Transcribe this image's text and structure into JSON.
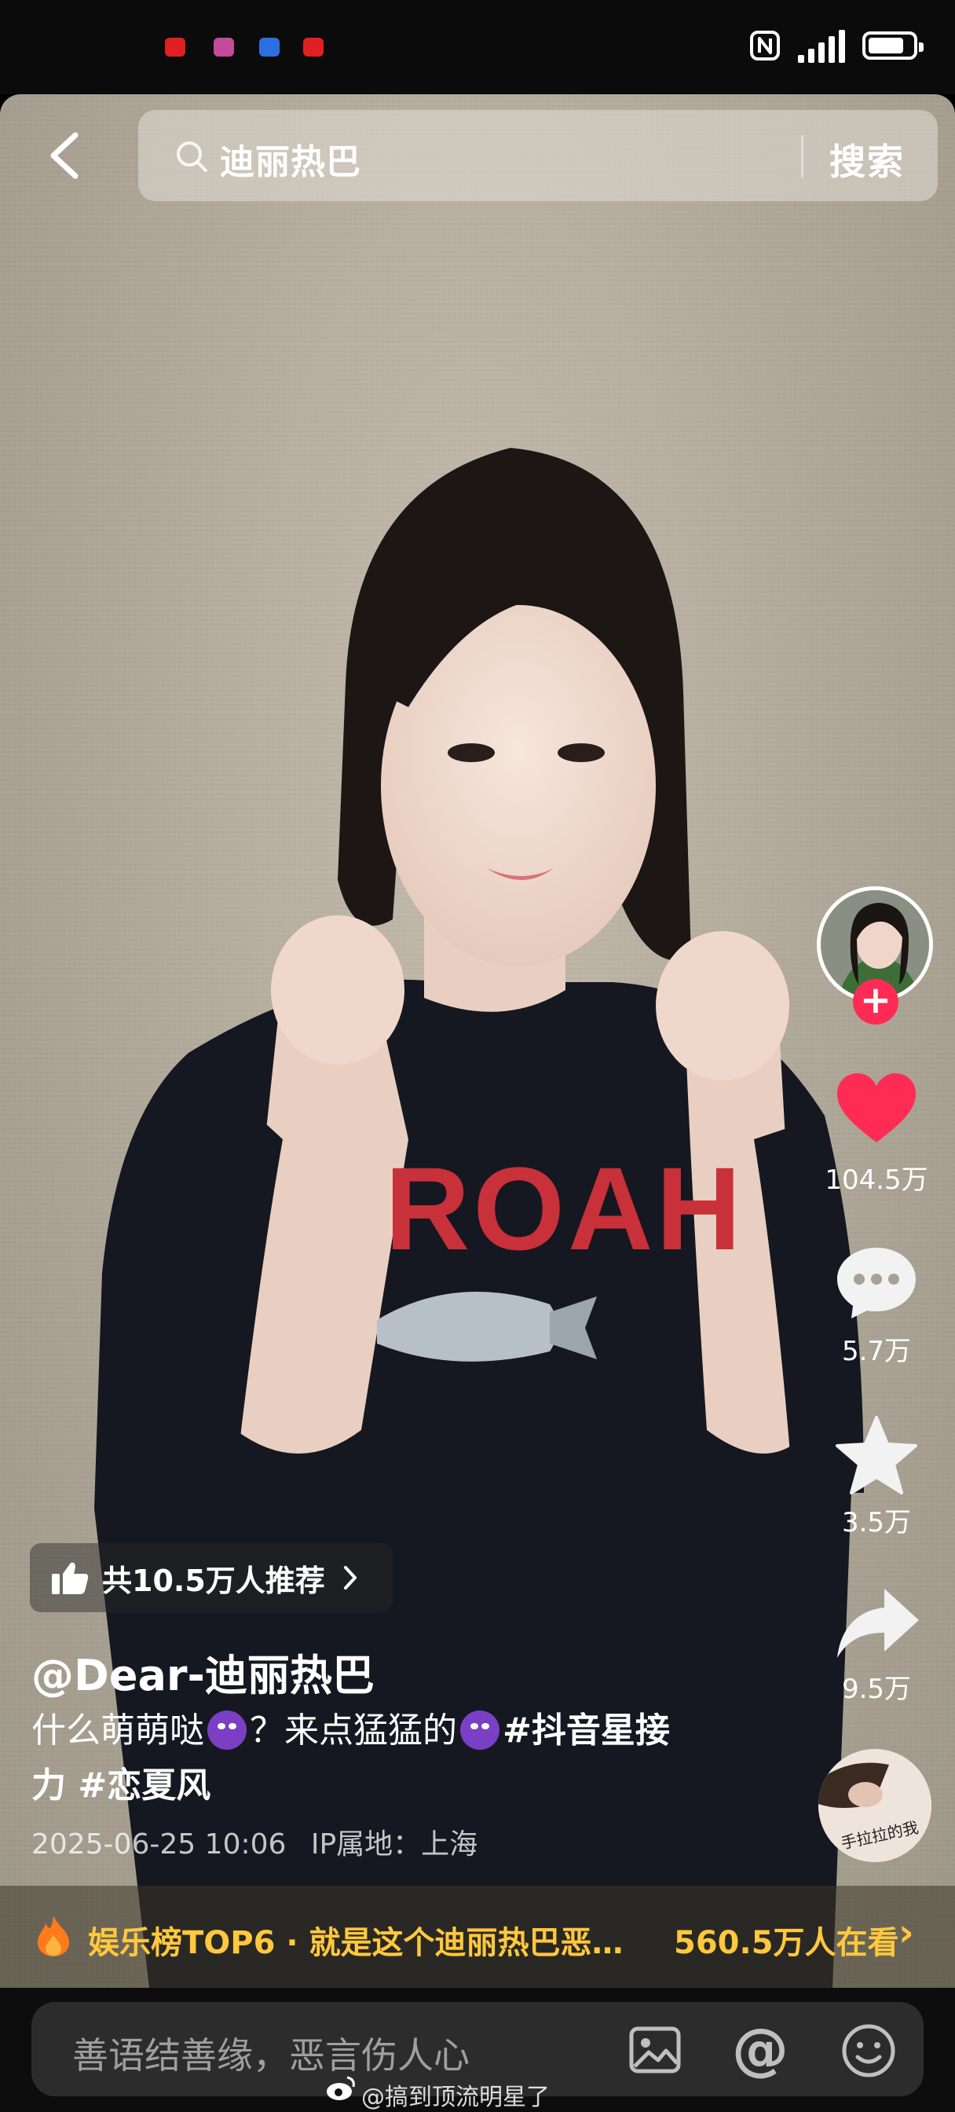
{
  "status_bar": {
    "notification_colors": [
      "#e02020",
      "#c44b9a",
      "#2d6fe0",
      "#e02020"
    ],
    "icons": [
      "nfc-icon",
      "signal-icon",
      "battery-icon"
    ]
  },
  "search": {
    "query": "迪丽热巴",
    "button_label": "搜索"
  },
  "sidebar": {
    "likes": "104.5万",
    "comments": "5.7万",
    "favorites": "3.5万",
    "shares": "9.5万",
    "follow_symbol": "+",
    "accent": "#fe2c55"
  },
  "video": {
    "shirt_text": "ROAH",
    "recommend_label": "共10.5万人推荐",
    "author": "@Dear-迪丽热巴",
    "desc_part1": "什么萌萌哒",
    "desc_part2": "？来点猛猛的",
    "desc_tag1": "#抖音星接",
    "desc_tag1_cont": "力",
    "desc_tag2": "#恋夏风",
    "timestamp": "2025-06-25 10:06",
    "ip_location": "IP属地：上海",
    "music_disc_text": "手拉拉的我"
  },
  "hot_banner": {
    "left_text": "娱乐榜TOP6 · 就是这个迪丽热巴恶…",
    "right_text": "560.5万人在看",
    "chevron": "›",
    "accent": "#ffc83d"
  },
  "comment_bar": {
    "placeholder": "善语结善缘，恶言伤人心",
    "at_symbol": "@"
  },
  "watermark": {
    "text": "@搞到顶流明星了"
  }
}
